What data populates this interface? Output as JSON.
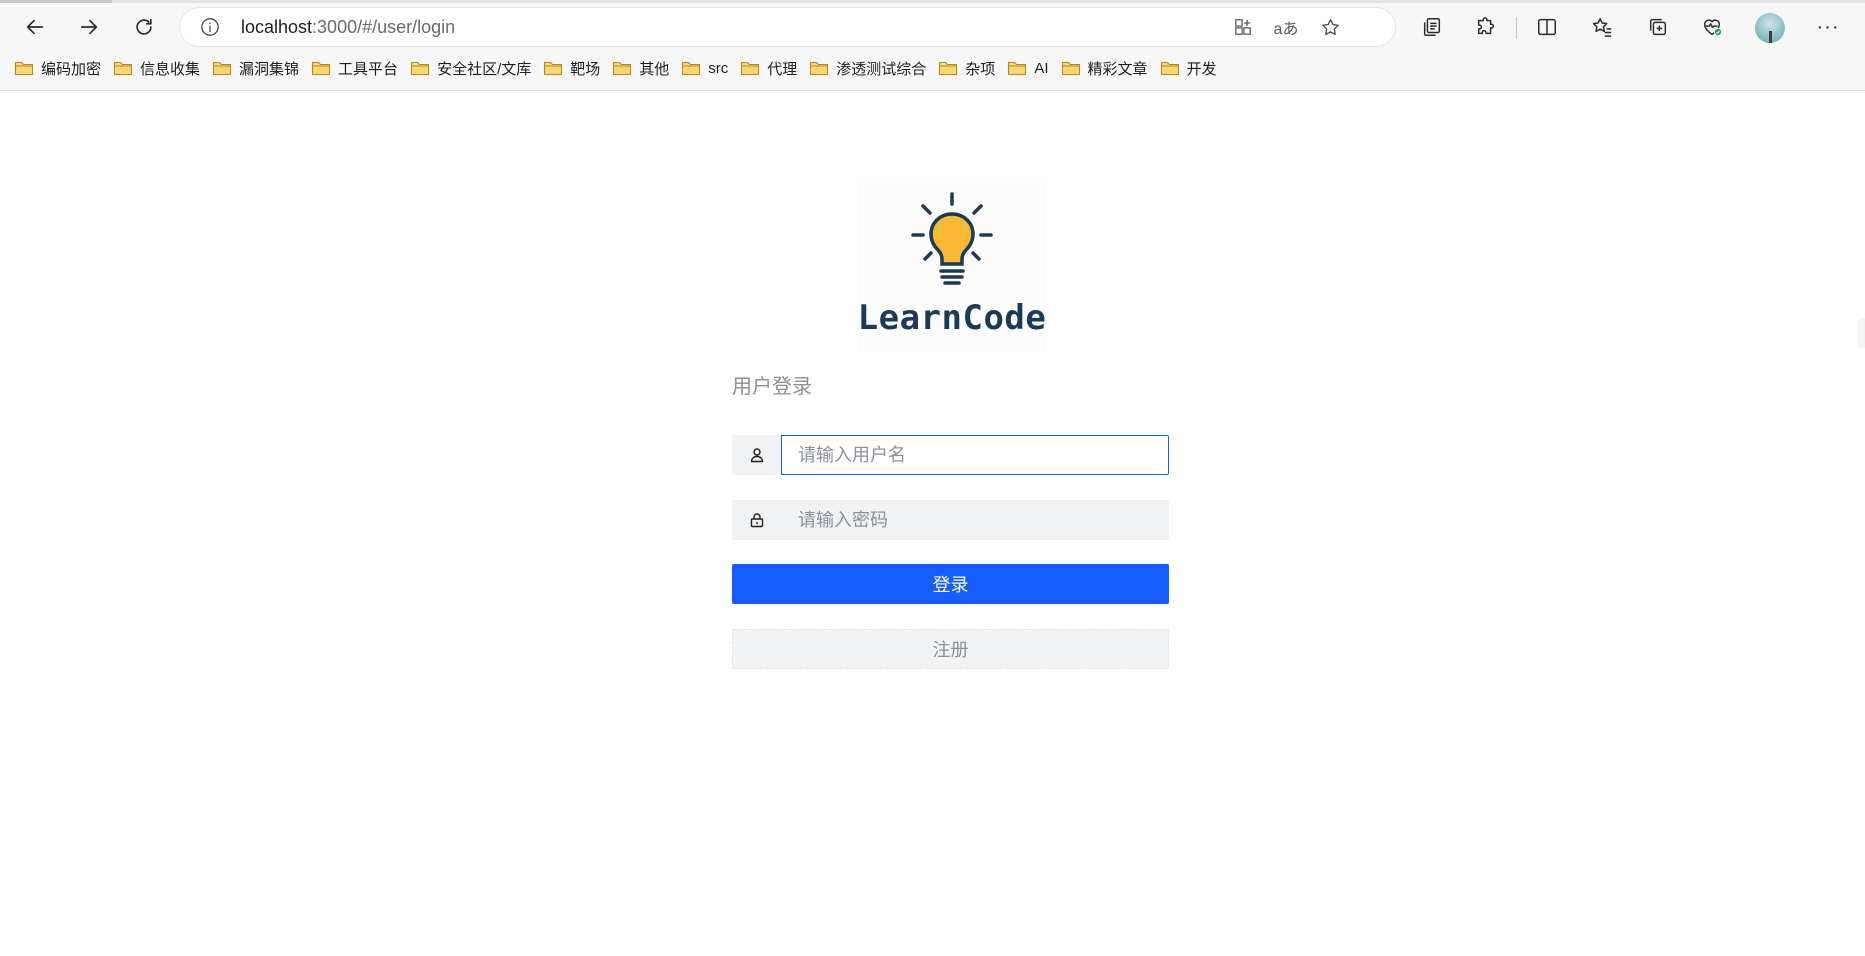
{
  "browser": {
    "url_host": "localhost",
    "url_path": ":3000/#/user/login",
    "read_aloud_icon_text": "aあ",
    "bookmarks": [
      {
        "label": "编码加密"
      },
      {
        "label": "信息收集"
      },
      {
        "label": "漏洞集锦"
      },
      {
        "label": "工具平台"
      },
      {
        "label": "安全社区/文库"
      },
      {
        "label": "靶场"
      },
      {
        "label": "其他"
      },
      {
        "label": "src"
      },
      {
        "label": "代理"
      },
      {
        "label": "渗透测试综合"
      },
      {
        "label": "杂项"
      },
      {
        "label": "AI"
      },
      {
        "label": "精彩文章"
      },
      {
        "label": "开发"
      }
    ],
    "more_icon_text": "···"
  },
  "login": {
    "logo_text": "LearnCode",
    "title": "用户登录",
    "username_placeholder": "请输入用户名",
    "username_value": "",
    "password_placeholder": "请输入密码",
    "password_value": "",
    "login_button": "登录",
    "register_button": "注册"
  },
  "colors": {
    "primary": "#165dff",
    "bulb_yellow": "#f9b934",
    "logo_navy": "#1b3a57",
    "folder_yellow": "#f8d775"
  }
}
